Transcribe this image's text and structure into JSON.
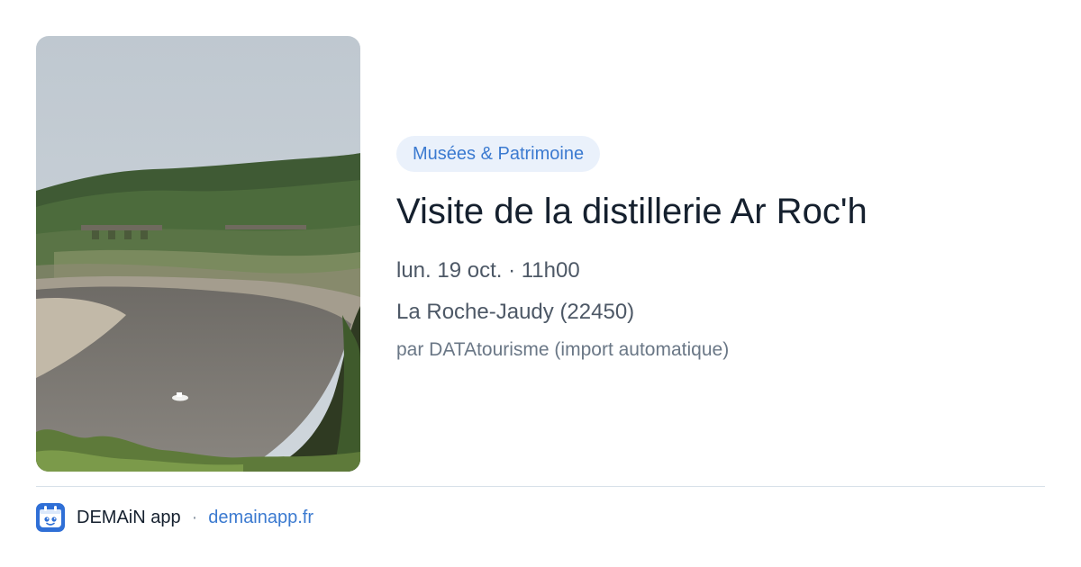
{
  "event": {
    "image_description": "river-valley-photo",
    "category": "Musées & Patrimoine",
    "title": "Visite de la distillerie Ar Roc'h",
    "date": "lun. 19 oct. · 11h00",
    "location": "La Roche-Jaudy (22450)",
    "source": "par DATAtourisme (import automatique)"
  },
  "footer": {
    "app_icon": "demain-app-icon",
    "app_name": "DEMAiN app",
    "separator": "·",
    "url": "demainapp.fr"
  },
  "colors": {
    "accent": "#3b7ad0",
    "badge_bg": "#eaf1fb",
    "title": "#15202e",
    "text": "#4d5866",
    "muted": "#6a7786",
    "divider": "#d8e1e9"
  }
}
